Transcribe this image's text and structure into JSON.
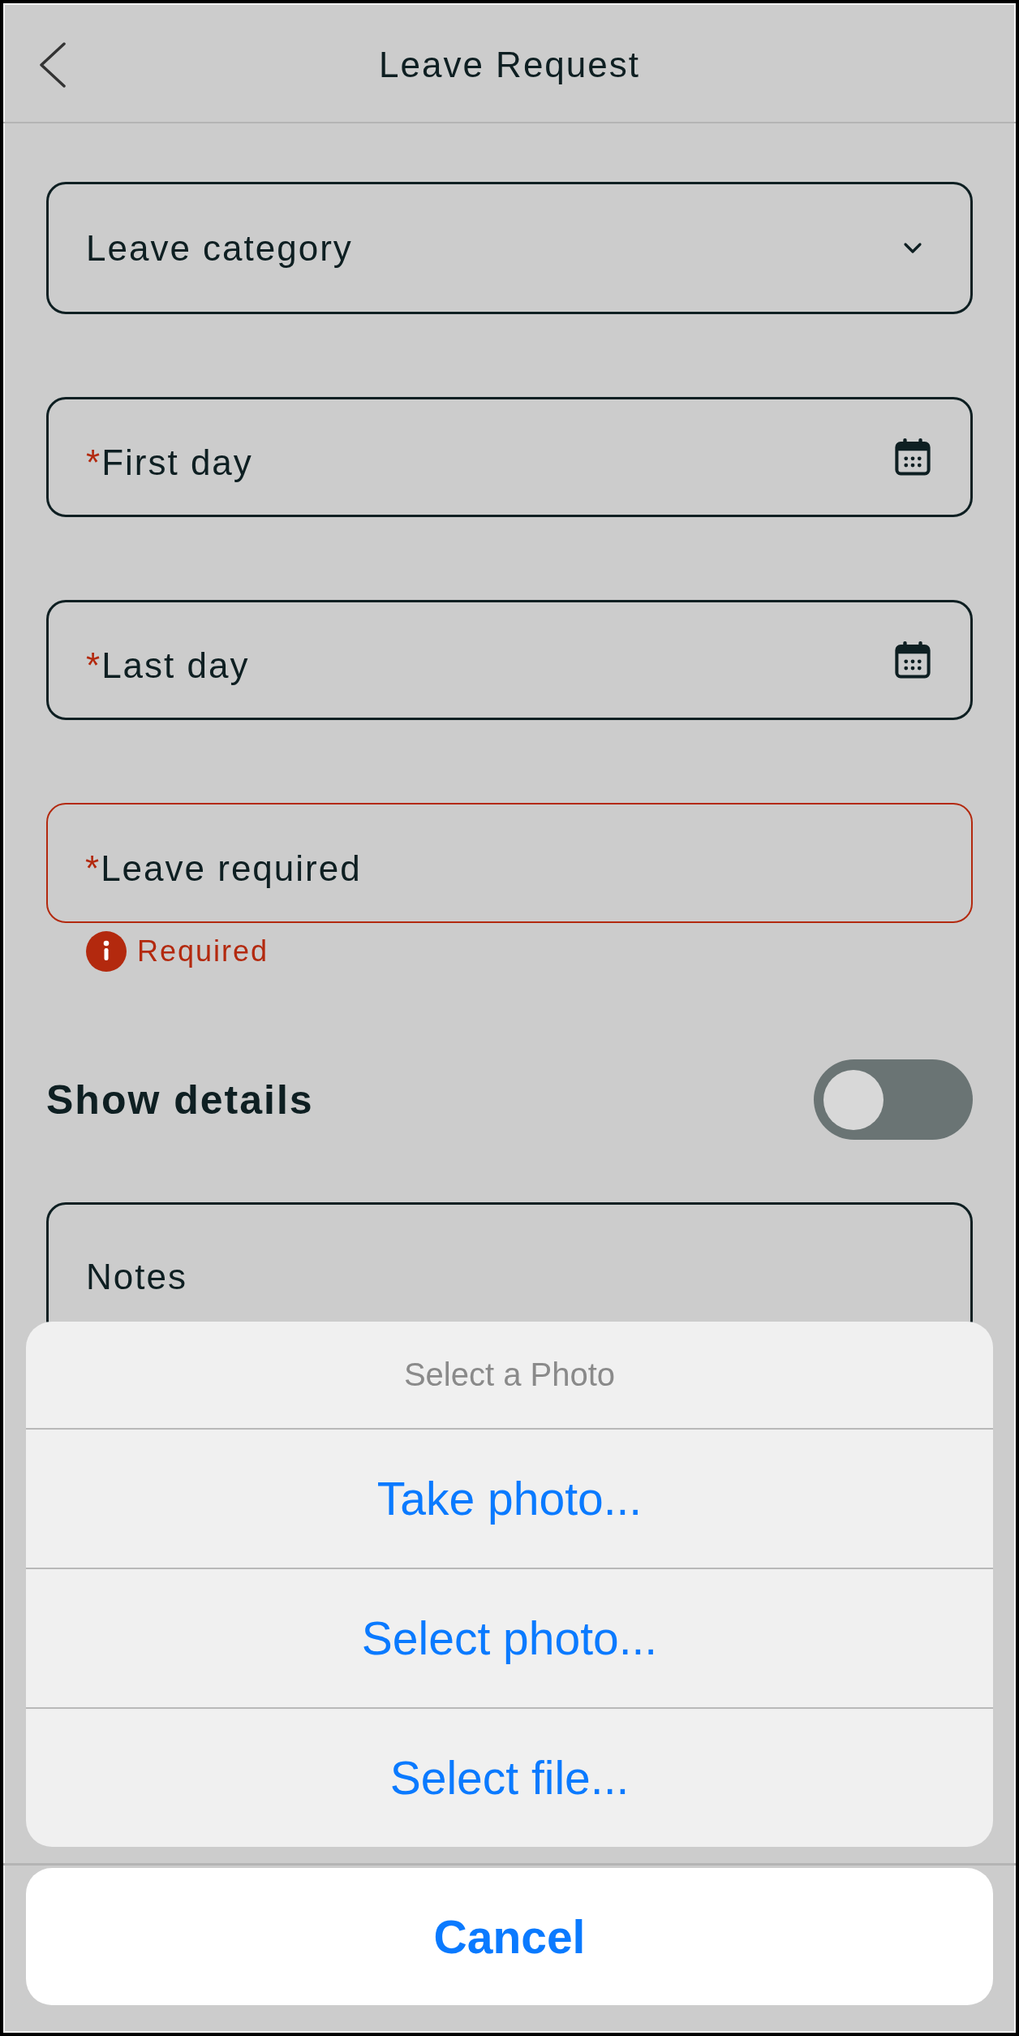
{
  "header": {
    "title": "Leave Request"
  },
  "fields": [
    {
      "kind": "select",
      "label": "Leave category",
      "error": false
    },
    {
      "kind": "date",
      "required_mark": "*",
      "label": "First day",
      "error": false
    },
    {
      "kind": "date",
      "required_mark": "*",
      "label": "Last day",
      "error": false
    },
    {
      "kind": "text",
      "required_mark": "*",
      "label": "Leave required",
      "error": true,
      "error_text": "Required"
    }
  ],
  "toggle": {
    "label": "Show details",
    "on": false
  },
  "notes": {
    "label": "Notes"
  },
  "action_sheet": {
    "title": "Select a Photo",
    "options": [
      "Take photo...",
      "Select photo...",
      "Select file..."
    ],
    "cancel": "Cancel"
  }
}
